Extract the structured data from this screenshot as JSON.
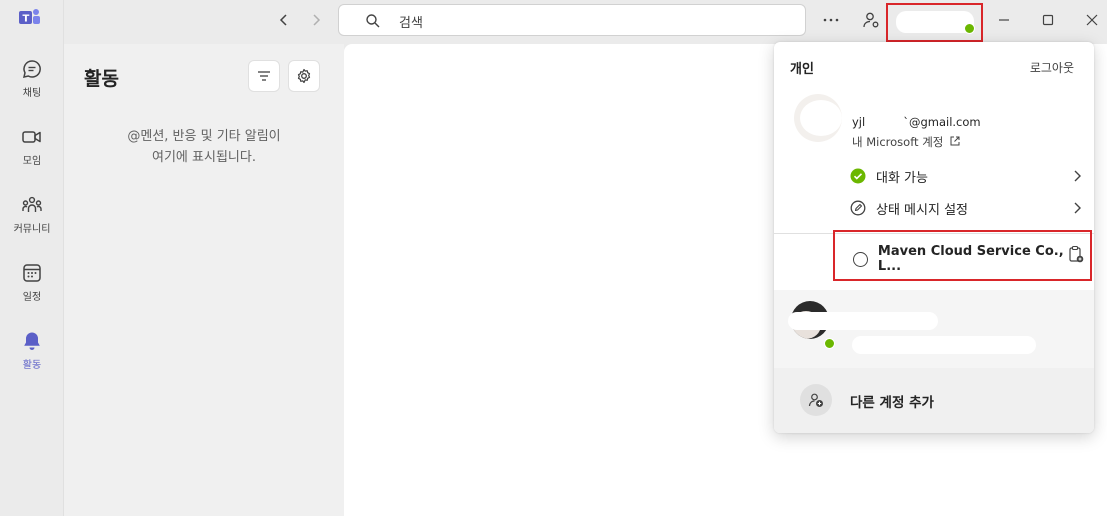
{
  "rail": {
    "items": [
      {
        "label": "채팅",
        "icon": "chat-icon"
      },
      {
        "label": "모임",
        "icon": "video-icon"
      },
      {
        "label": "커뮤니티",
        "icon": "community-icon"
      },
      {
        "label": "일정",
        "icon": "calendar-icon"
      },
      {
        "label": "활동",
        "icon": "bell-icon",
        "active": true
      }
    ]
  },
  "panel": {
    "title": "활동",
    "empty_line1": "@멘션, 반응 및 기타 알림이",
    "empty_line2": "여기에 표시됩니다."
  },
  "search": {
    "placeholder": "검색"
  },
  "dropdown": {
    "header": "개인",
    "logout": "로그아웃",
    "email_prefix": "yjl",
    "email_suffix": "`@gmail.com",
    "ms_account": "내 Microsoft 계정",
    "status": "대화 가능",
    "status_message": "상태 메시지 설정",
    "org_name": "Maven Cloud Service Co., L...",
    "add_account": "다른 계정 추가"
  },
  "colors": {
    "accent": "#5b5fc7",
    "available": "#6bb700",
    "highlight": "#d9262a"
  }
}
